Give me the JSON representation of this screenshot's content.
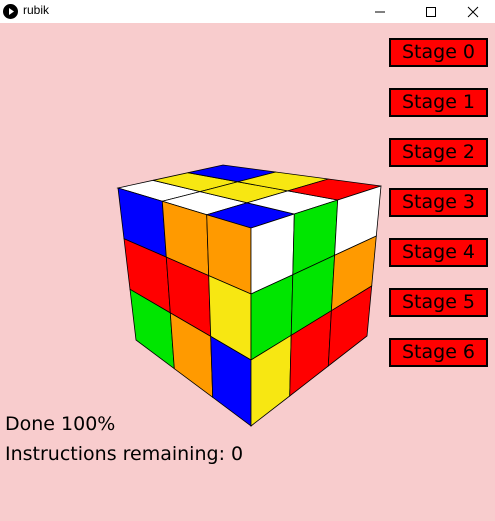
{
  "window": {
    "title": "rubik"
  },
  "stages": [
    "Stage 0",
    "Stage 1",
    "Stage 2",
    "Stage 3",
    "Stage 4",
    "Stage 5",
    "Stage 6"
  ],
  "status": {
    "done": "Done 100%",
    "remaining": "Instructions remaining: 0"
  },
  "colors": {
    "background": "#f8cccd",
    "button": "#ff0000",
    "W": "#ffffff",
    "Y": "#f7e712",
    "B": "#0000ff",
    "G": "#00e600",
    "R": "#ff0000",
    "O": "#ff9a00"
  },
  "cube": {
    "top": [
      [
        "W",
        "Y",
        "B"
      ],
      [
        "W",
        "Y",
        "Y"
      ],
      [
        "B",
        "W",
        "R"
      ]
    ],
    "left": [
      [
        "B",
        "O",
        "O"
      ],
      [
        "R",
        "R",
        "Y"
      ],
      [
        "G",
        "O",
        "B"
      ]
    ],
    "right": [
      [
        "W",
        "G",
        "W"
      ],
      [
        "G",
        "G",
        "O"
      ],
      [
        "Y",
        "R",
        "R"
      ]
    ]
  }
}
